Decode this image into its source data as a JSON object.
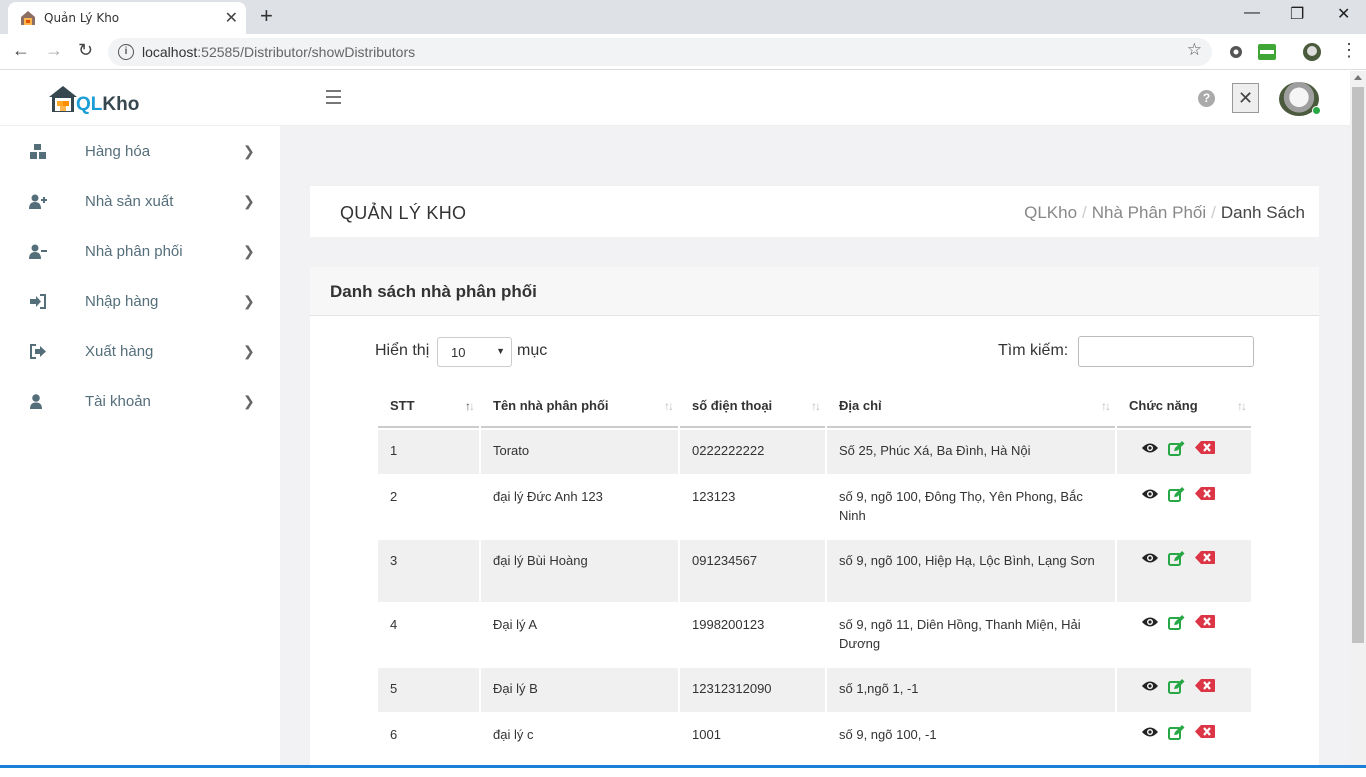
{
  "browser": {
    "tab_title": "Quản Lý Kho",
    "url_host": "localhost",
    "url_rest": ":52585/Distributor/showDistributors"
  },
  "header": {
    "logo_q": "QL",
    "logo_rest": "Kho"
  },
  "sidebar": {
    "items": [
      {
        "label": "Hàng hóa",
        "icon": "boxes-icon"
      },
      {
        "label": "Nhà sản xuất",
        "icon": "user-plus-icon"
      },
      {
        "label": "Nhà phân phối",
        "icon": "user-minus-icon"
      },
      {
        "label": "Nhập hàng",
        "icon": "sign-in-icon"
      },
      {
        "label": "Xuất hàng",
        "icon": "sign-out-icon"
      },
      {
        "label": "Tài khoản",
        "icon": "user-icon"
      }
    ]
  },
  "page": {
    "title": "QUẢN LÝ KHO",
    "breadcrumb": [
      "QLKho",
      "Nhà Phân Phối",
      "Danh Sách"
    ]
  },
  "card": {
    "title": "Danh sách nhà phân phối",
    "length_prefix": "Hiển thị",
    "length_value": "10",
    "length_suffix": "mục",
    "search_label": "Tìm kiếm:",
    "search_value": ""
  },
  "table": {
    "columns": [
      "STT",
      "Tên nhà phân phối",
      "số điện thoại",
      "Địa chỉ",
      "Chức năng"
    ],
    "rows": [
      [
        "1",
        "Torato",
        "0222222222",
        "Số 25, Phúc Xá, Ba Đình, Hà Nội"
      ],
      [
        "2",
        "đại lý Đức Anh 123",
        "123123",
        "số 9, ngõ 100, Đông Thọ, Yên Phong, Bắc Ninh"
      ],
      [
        "3",
        "đại lý Bùi Hoàng",
        "091234567",
        "số 9, ngõ 100, Hiệp Hạ, Lộc Bình, Lạng Sơn"
      ],
      [
        "4",
        "Đại lý A",
        "1998200123",
        "số 9, ngõ 11, Diên Hồng, Thanh Miện, Hải Dương"
      ],
      [
        "5",
        "Đại lý B",
        "12312312090",
        "số 1,ngõ 1, -1"
      ],
      [
        "6",
        "đại lý c",
        "1001",
        "số 9, ngõ 100, -1"
      ]
    ]
  },
  "colors": {
    "accent": "#1a9dd6",
    "view": "#222222",
    "edit": "#28a745",
    "delete": "#dc3545"
  }
}
